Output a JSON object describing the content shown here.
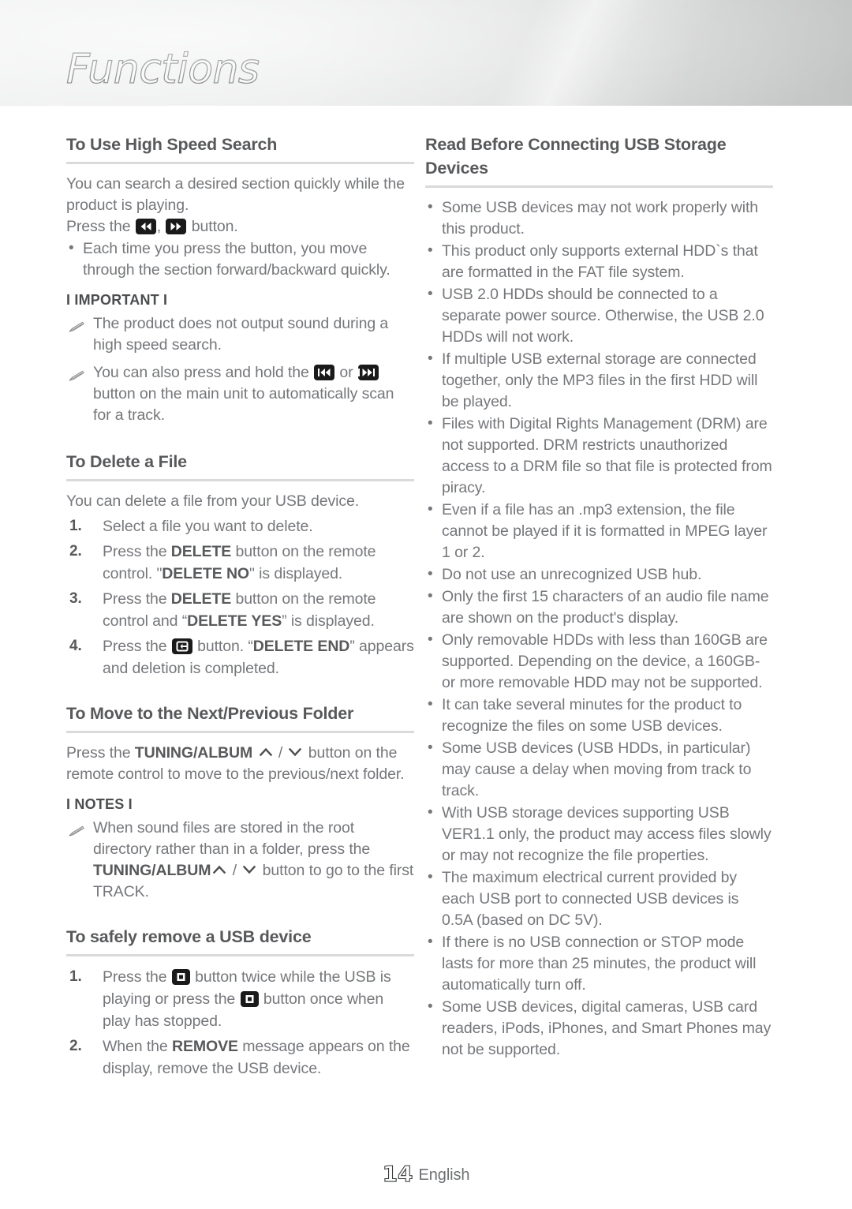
{
  "header": {
    "title": "Functions"
  },
  "footer": {
    "page_number": "14",
    "language": "English"
  },
  "left_column": {
    "sections": [
      {
        "id": "high-speed-search",
        "title": "To Use High Speed Search",
        "p1": "You can search a desired section quickly while the product is playing.",
        "p2_before": "Press the ",
        "p2_mid": ", ",
        "p2_after": " button.",
        "bullet1": "Each time you press the button, you move through the section forward/backward quickly.",
        "note_label": "I IMPORTANT I",
        "note1": "The product does not output sound during a high speed search.",
        "note2_before": "You can also press and hold the ",
        "note2_mid": " or ",
        "note2_after": " button on the main unit to automatically scan for a track."
      },
      {
        "id": "delete-file",
        "title": "To Delete a File",
        "intro": "You can delete a file from your USB device.",
        "step1": "Select a file you want to delete.",
        "step2_a": "Press the ",
        "step2_b": "DELETE",
        "step2_c": " button on the remote control. \"",
        "step2_d": "DELETE NO",
        "step2_e": "\" is displayed.",
        "step3_a": "Press the ",
        "step3_b": "DELETE",
        "step3_c": " button on the remote control and “",
        "step3_d": "DELETE YES",
        "step3_e": "” is displayed.",
        "step4_a": "Press the ",
        "step4_b": " button. “",
        "step4_c": "DELETE END",
        "step4_d": "” appears and deletion is completed."
      },
      {
        "id": "next-previous-folder",
        "title": "To Move to the Next/Previous Folder",
        "p1_a": "Press the ",
        "p1_b": "TUNING/ALBUM",
        "p1_c": " ",
        "p1_d": " / ",
        "p1_e": " button on the remote control to move to the previous/next folder.",
        "note_label": "I NOTES I",
        "note1_a": "When sound files are stored in the root directory rather than in a folder, press the ",
        "note1_b": "TUNING/ALBUM",
        "note1_c": " / ",
        "note1_d": " button to go to the first TRACK."
      },
      {
        "id": "safely-remove-usb",
        "title": "To safely remove a USB device",
        "step1_a": "Press the ",
        "step1_b": " button twice while the USB is playing or press the ",
        "step1_c": " button once when play has stopped.",
        "step2_a": "When the ",
        "step2_b": "REMOVE",
        "step2_c": " message appears on the display, remove the USB device."
      }
    ]
  },
  "right_column": {
    "section": {
      "id": "read-before-connecting-usb",
      "title": "Read Before Connecting USB Storage Devices",
      "bullets": [
        "Some USB devices may not work properly with this product.",
        "This product only supports external HDD`s that are formatted in the FAT file system.",
        "USB 2.0 HDDs should be connected to a separate power source. Otherwise, the USB 2.0 HDDs will not work.",
        "If multiple USB external storage are connected together, only the MP3 files in the first HDD will be played.",
        "Files with Digital Rights Management (DRM) are not supported. DRM restricts unauthorized access to a DRM file so that file is protected from piracy.",
        "Even if a file has an .mp3 extension, the file cannot be played if it is formatted in MPEG layer 1 or 2.",
        "Do not use an unrecognized USB hub.",
        "Only the first 15 characters of an audio file name are shown on the product's display.",
        "Only removable HDDs with less than 160GB are supported. Depending on the device, a 160GB- or more removable HDD may not be supported.",
        "It can take several minutes for the product to recognize the files on some USB devices.",
        "Some USB devices (USB HDDs, in particular) may cause a delay when moving from track to track.",
        "With USB storage devices supporting USB VER1.1 only, the product may access files slowly or may not recognize the file properties.",
        "The maximum electrical current provided by each USB port to connected USB devices is 0.5A (based on DC 5V).",
        "If there is no USB connection or STOP mode lasts for more than 25 minutes, the product will automatically turn off.",
        "Some USB devices, digital cameras, USB card readers, iPods, iPhones, and Smart Phones may not be supported."
      ]
    }
  },
  "icons": {
    "rewind": "rewind-button-icon",
    "fast_forward": "fast-forward-button-icon",
    "skip_back": "skip-back-button-icon",
    "skip_forward": "skip-forward-button-icon",
    "enter": "enter-button-icon",
    "stop": "stop-button-icon",
    "chevron_up": "chevron-up-icon",
    "chevron_down": "chevron-down-icon",
    "note": "pencil-note-icon"
  },
  "colors": {
    "heading": "#58595b",
    "body": "#75777a",
    "rule": "#d9dadb",
    "button": "#1a1a1a"
  }
}
